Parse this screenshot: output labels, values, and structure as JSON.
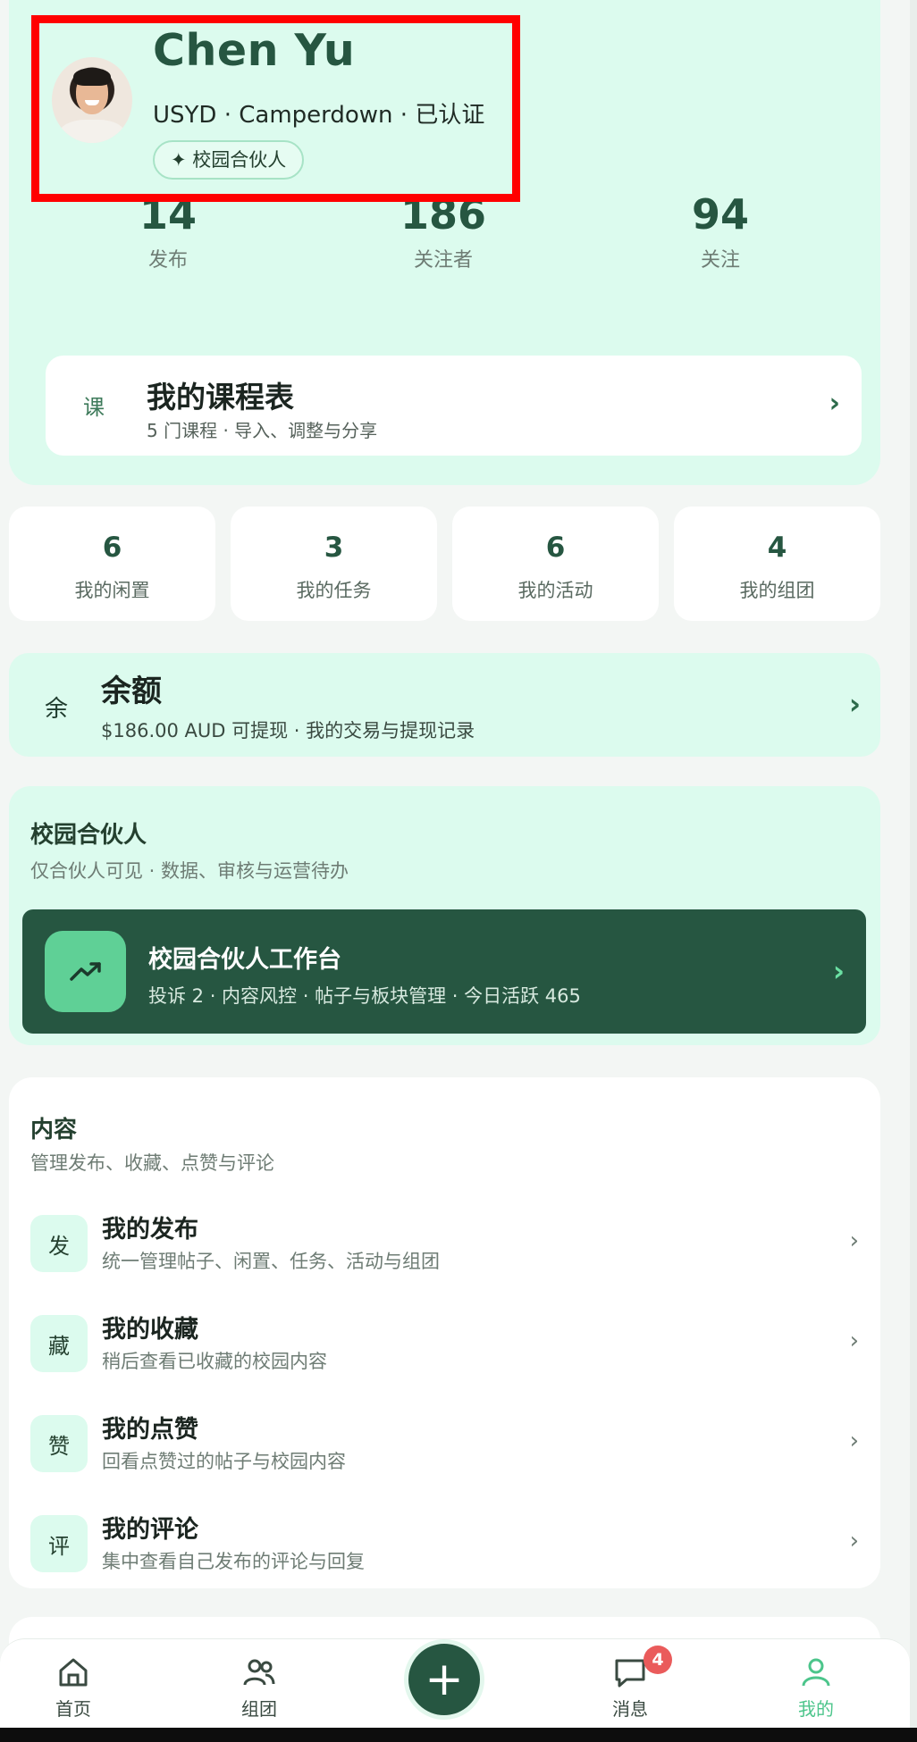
{
  "profile": {
    "name": "Chen Yu",
    "school": "USYD · Camperdown · 已认证",
    "badge_icon": "sparkle-icon",
    "badge": "✦ 校园合伙人"
  },
  "stats": [
    {
      "value": "14",
      "label": "发布"
    },
    {
      "value": "186",
      "label": "关注者"
    },
    {
      "value": "94",
      "label": "关注"
    }
  ],
  "schedule": {
    "icon": "课",
    "title": "我的课程表",
    "subtitle": "5 门课程 · 导入、调整与分享",
    "chevron": "›"
  },
  "quick": [
    {
      "value": "6",
      "label": "我的闲置"
    },
    {
      "value": "3",
      "label": "我的任务"
    },
    {
      "value": "6",
      "label": "我的活动"
    },
    {
      "value": "4",
      "label": "我的组团"
    }
  ],
  "balance": {
    "icon": "余",
    "title": "余额",
    "subtitle": "$186.00 AUD 可提现 · 我的交易与提现记录",
    "chevron": "›"
  },
  "partner": {
    "title": "校园合伙人",
    "subtitle": "仅合伙人可见 · 数据、审核与运营待办",
    "workbench_title": "校园合伙人工作台",
    "workbench_subtitle": "投诉 2 · 内容风控 · 帖子与板块管理 · 今日活跃 465",
    "chevron": "›"
  },
  "content": {
    "title": "内容",
    "subtitle": "管理发布、收藏、点赞与评论",
    "items": [
      {
        "icon": "发",
        "title": "我的发布",
        "subtitle": "统一管理帖子、闲置、任务、活动与组团",
        "chevron": "›"
      },
      {
        "icon": "藏",
        "title": "我的收藏",
        "subtitle": "稍后查看已收藏的校园内容",
        "chevron": "›"
      },
      {
        "icon": "赞",
        "title": "我的点赞",
        "subtitle": "回看点赞过的帖子与校园内容",
        "chevron": "›"
      },
      {
        "icon": "评",
        "title": "我的评论",
        "subtitle": "集中查看自己发布的评论与回复",
        "chevron": "›"
      }
    ]
  },
  "tabbar": {
    "home": "首页",
    "groups": "组团",
    "add": "+",
    "messages": "消息",
    "messages_badge": "4",
    "me": "我的"
  },
  "colors": {
    "brand_dark": "#265641",
    "mint": "#dcfbee",
    "accent_green": "#4cc58b",
    "badge_red": "#ea5b5b"
  }
}
